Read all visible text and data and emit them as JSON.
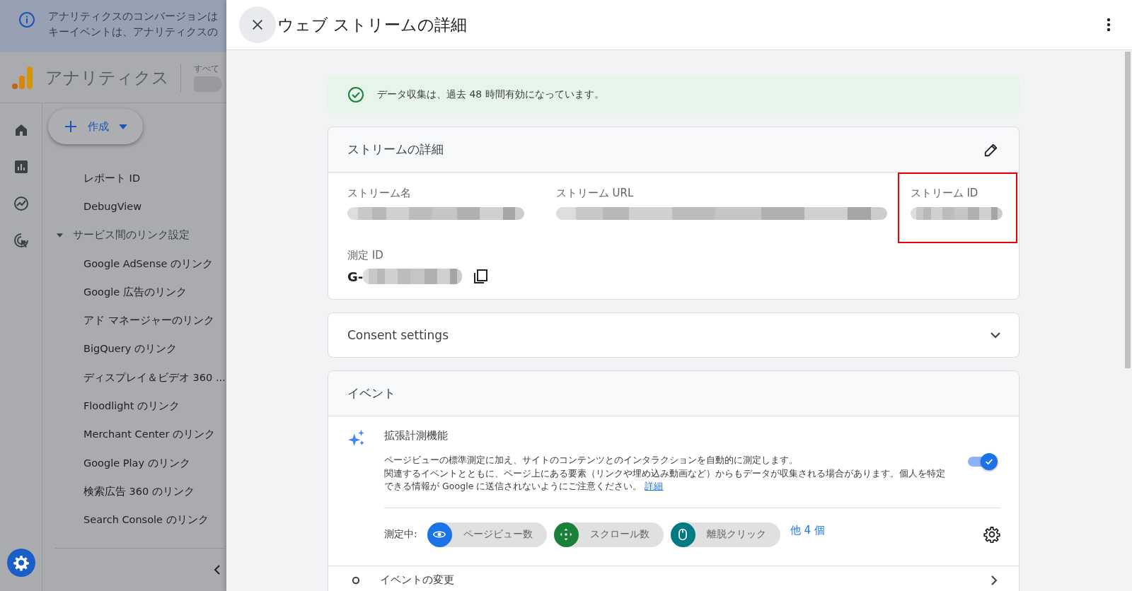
{
  "background_page": {
    "banner_lines": [
      "アナリティクスのコンバージョンは",
      "キーイベントは、アナリティクスの"
    ],
    "app_title": "アナリティクス",
    "account_label": "すべて",
    "account_redacted": true,
    "create_button": "作成",
    "nav": [
      {
        "label": "レポート ID"
      },
      {
        "label": "DebugView"
      },
      {
        "label": "サービス間のリンク設定",
        "expanded": true,
        "children": [
          {
            "label": "Google AdSense のリンク"
          },
          {
            "label": "Google 広告のリンク"
          },
          {
            "label": "アド マネージャーのリンク"
          },
          {
            "label": "BigQuery のリンク"
          },
          {
            "label": "ディスプレイ＆ビデオ 360 ..."
          },
          {
            "label": "Floodlight のリンク"
          },
          {
            "label": "Merchant Center のリンク"
          },
          {
            "label": "Google Play のリンク"
          },
          {
            "label": "検索広告 360 のリンク"
          },
          {
            "label": "Search Console のリンク"
          }
        ]
      }
    ]
  },
  "panel": {
    "title": "ウェブ ストリームの詳細",
    "status_banner": "データ収集は、過去 48 時間有効になっています。",
    "stream_card": {
      "title": "ストリームの詳細",
      "fields": [
        {
          "label": "ストリーム名",
          "redacted": true,
          "highlighted": false
        },
        {
          "label": "ストリーム URL",
          "redacted": true,
          "highlighted": false
        },
        {
          "label": "ストリーム ID",
          "redacted": true,
          "highlighted": true
        }
      ],
      "measurement_id": {
        "label": "測定 ID",
        "prefix": "G-",
        "redacted": true
      }
    },
    "consent": {
      "title": "Consent settings",
      "expanded": false
    },
    "events": {
      "title": "イベント",
      "enhanced": {
        "title": "拡張計測機能",
        "description": [
          "ページビューの標準測定に加え、サイトのコンテンツとのインタラクションを自動的に測定します。",
          "関連するイベントとともに、ページ上にある要素（リンクや埋め込み動画など）からもデータが収集される場合があります。個人を特定できる情報が Google に送信されないようにご注意ください。"
        ],
        "link": "詳細",
        "on": true,
        "measuring_label": "測定中:",
        "chips": [
          {
            "kind": "eye",
            "label": "ページビュー数",
            "color": "#1a73e8"
          },
          {
            "kind": "scroll",
            "label": "スクロール数",
            "color": "#188038"
          },
          {
            "kind": "mouse",
            "label": "離脱クリック",
            "color": "#007b83"
          }
        ],
        "more": "他 4 個"
      },
      "next_row": "イベントの変更"
    }
  }
}
